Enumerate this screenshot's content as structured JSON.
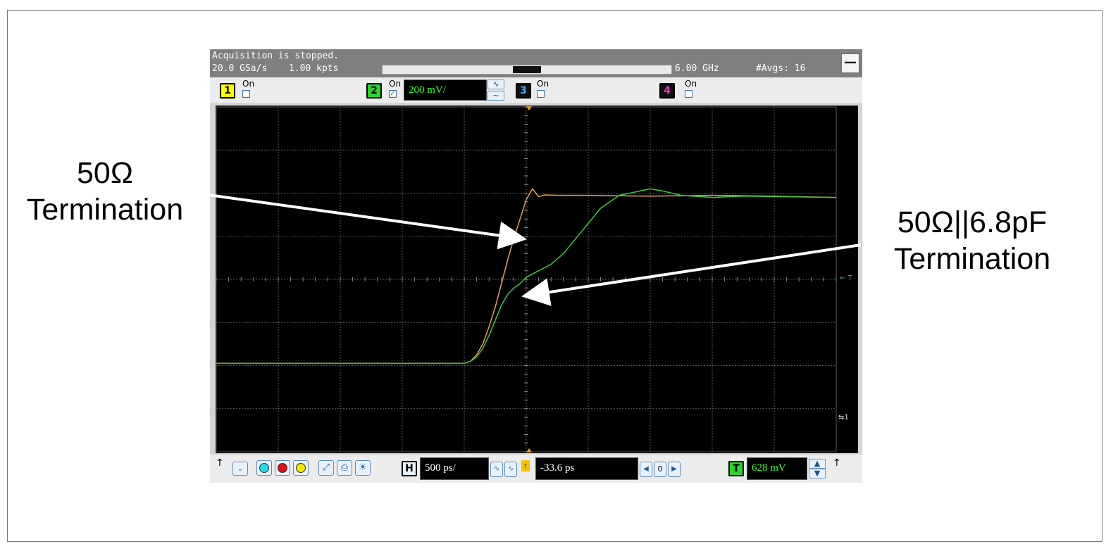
{
  "annotations": {
    "left_line1": "50Ω",
    "left_line2": "Termination",
    "right_line1": "50Ω||6.8pF",
    "right_line2": "Termination"
  },
  "scope": {
    "status": {
      "acquisition": "Acquisition is stopped.",
      "sample_rate": "20.0 GSa/s",
      "points": "1.00 kpts",
      "bandwidth": "6.00 GHz",
      "averages": "#Avgs: 16",
      "minimize_glyph": "—"
    },
    "channels": [
      {
        "number": "1",
        "state": "On",
        "checked": false,
        "color": "#ffff00"
      },
      {
        "number": "2",
        "state": "On",
        "checked": true,
        "color": "#00e000",
        "scale": "200 mV/"
      },
      {
        "number": "3",
        "state": "On",
        "checked": false,
        "color": "#4aa8ff"
      },
      {
        "number": "4",
        "state": "On",
        "checked": false,
        "color": "#ff30c0"
      }
    ],
    "bottom": {
      "horizontal_label": "H",
      "horizontal_scale": "500 ps/",
      "delay": "-33.6 ps",
      "zero_label": "0",
      "trigger_label": "T",
      "trigger_level": "628 mV"
    },
    "markers": {
      "trigger_marker": "← T",
      "ground_marker": "⇆1"
    },
    "colors": {
      "trace_50ohm": "#e8a050",
      "trace_cap": "#38c838",
      "grid": "#5a5a5a",
      "screen_bg": "#000000"
    }
  },
  "chart_data": {
    "type": "line",
    "x_unit": "divisions",
    "y_unit": "divisions",
    "xlim": [
      -5,
      5
    ],
    "ylim": [
      -4,
      4
    ],
    "series": [
      {
        "x": [
          -5,
          -1,
          -0.9,
          -0.8,
          -0.7,
          -0.6,
          -0.5,
          -0.4,
          -0.3,
          -0.2,
          -0.1,
          0,
          0.1,
          0.2,
          0.3,
          0.5,
          1,
          2,
          3,
          4,
          5
        ],
        "y": [
          -1.95,
          -1.95,
          -1.9,
          -1.75,
          -1.5,
          -1.1,
          -0.65,
          -0.1,
          0.45,
          0.95,
          1.4,
          1.85,
          2.1,
          1.92,
          1.96,
          1.95,
          1.95,
          1.93,
          1.95,
          1.93,
          1.9
        ]
      },
      {
        "x": [
          -5,
          -1,
          -0.9,
          -0.8,
          -0.7,
          -0.6,
          -0.5,
          -0.4,
          -0.3,
          -0.2,
          -0.1,
          0,
          0.2,
          0.4,
          0.6,
          0.8,
          1,
          1.2,
          1.5,
          2,
          2.2,
          2.5,
          3,
          3.5,
          4,
          5
        ],
        "y": [
          -1.95,
          -1.95,
          -1.9,
          -1.8,
          -1.6,
          -1.3,
          -0.95,
          -0.6,
          -0.35,
          -0.2,
          -0.1,
          0.05,
          0.2,
          0.35,
          0.6,
          0.95,
          1.3,
          1.65,
          1.95,
          2.1,
          2.05,
          1.95,
          1.9,
          1.93,
          1.92,
          1.9
        ]
      }
    ]
  }
}
